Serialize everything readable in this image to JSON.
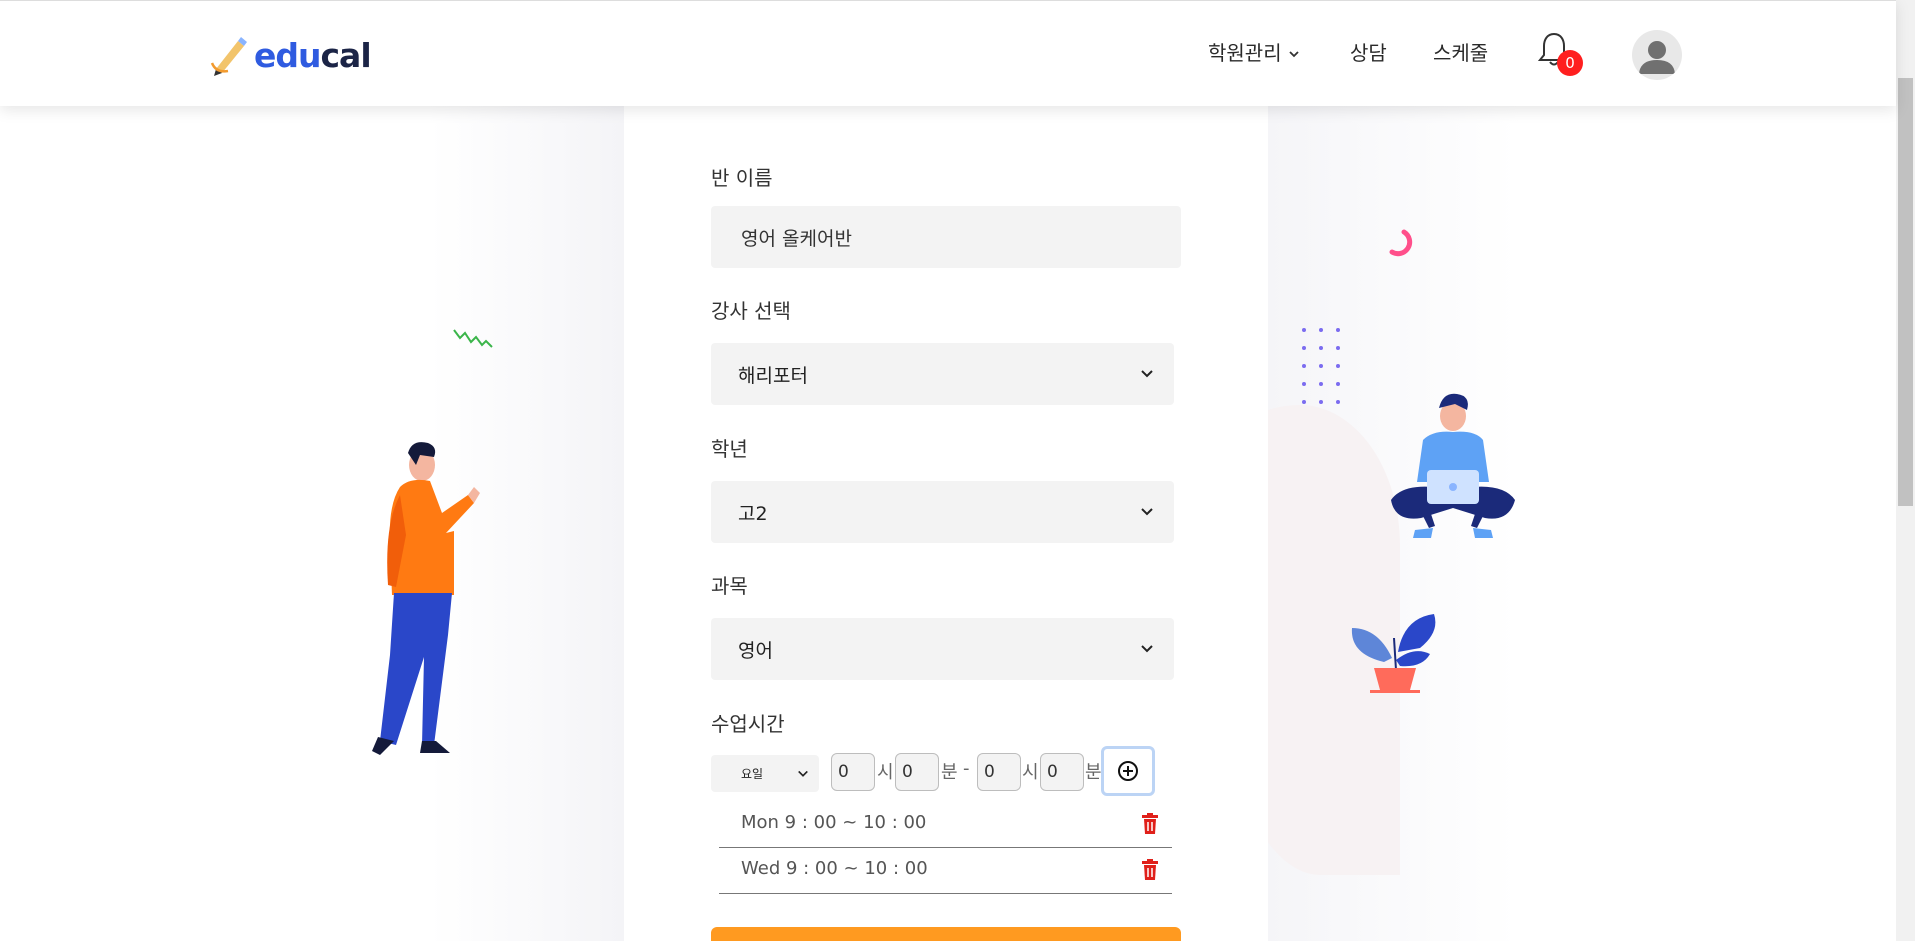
{
  "header": {
    "logo": {
      "part1": "edu",
      "part2": "cal"
    },
    "nav": {
      "academy": "학원관리",
      "consult": "상담",
      "schedule": "스케줄"
    },
    "notification_count": "0"
  },
  "form": {
    "class_name": {
      "label": "반 이름",
      "value": "영어 올케어반"
    },
    "teacher": {
      "label": "강사 선택",
      "value": "해리포터"
    },
    "grade": {
      "label": "학년",
      "value": "고2"
    },
    "subject": {
      "label": "과목",
      "value": "영어"
    },
    "class_time": {
      "label": "수업시간",
      "day_select": "요일",
      "start_hour": "0",
      "start_min": "0",
      "end_hour": "0",
      "end_min": "0",
      "unit_hour": "시",
      "unit_min": "분",
      "separator": "-"
    },
    "schedules": [
      {
        "text": "Mon 9 : 00 ~ 10 : 00"
      },
      {
        "text": "Wed 9 : 00 ~ 10 : 00"
      }
    ]
  },
  "colors": {
    "brand_blue": "#2f5be0",
    "brand_dark": "#1b2446",
    "badge_red": "#ff1f1f",
    "submit_orange": "#ff9a20",
    "trash_red": "#e0201a"
  }
}
